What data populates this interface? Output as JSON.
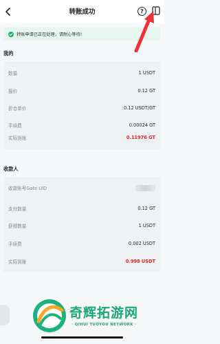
{
  "header": {
    "title": "转账成功"
  },
  "banner": {
    "text": "转账申请已正在处理，请耐心等待!"
  },
  "mine": {
    "title": "我的",
    "rows": [
      {
        "label": "数量",
        "value": "1 USDT"
      },
      {
        "label": "报价",
        "value": "0.12 GT"
      },
      {
        "label": "折合单价",
        "value": "0.12 USDT/GT"
      },
      {
        "label": "手续费",
        "value": "0.00024 GT"
      },
      {
        "label": "实际到账",
        "value": "0.11976 GT"
      }
    ]
  },
  "payee": {
    "title": "收款人",
    "rows": [
      {
        "label": "收款账号Gate UID",
        "value": ""
      },
      {
        "label": "支付数量",
        "value": "0.12 GT"
      },
      {
        "label": "获得数量",
        "value": "1 USDT"
      },
      {
        "label": "手续费",
        "value": "0.002 USDT"
      },
      {
        "label": "实际到账",
        "value": "0.998 USDT"
      }
    ]
  },
  "watermark": {
    "text": "奇辉拓游网",
    "subtext": "· QIHUI TUOYOU NETWORK ·"
  },
  "colors": {
    "accent_green": "#20b26c",
    "alert_red": "#e0242c",
    "arrow_red": "#ef2f3a"
  }
}
